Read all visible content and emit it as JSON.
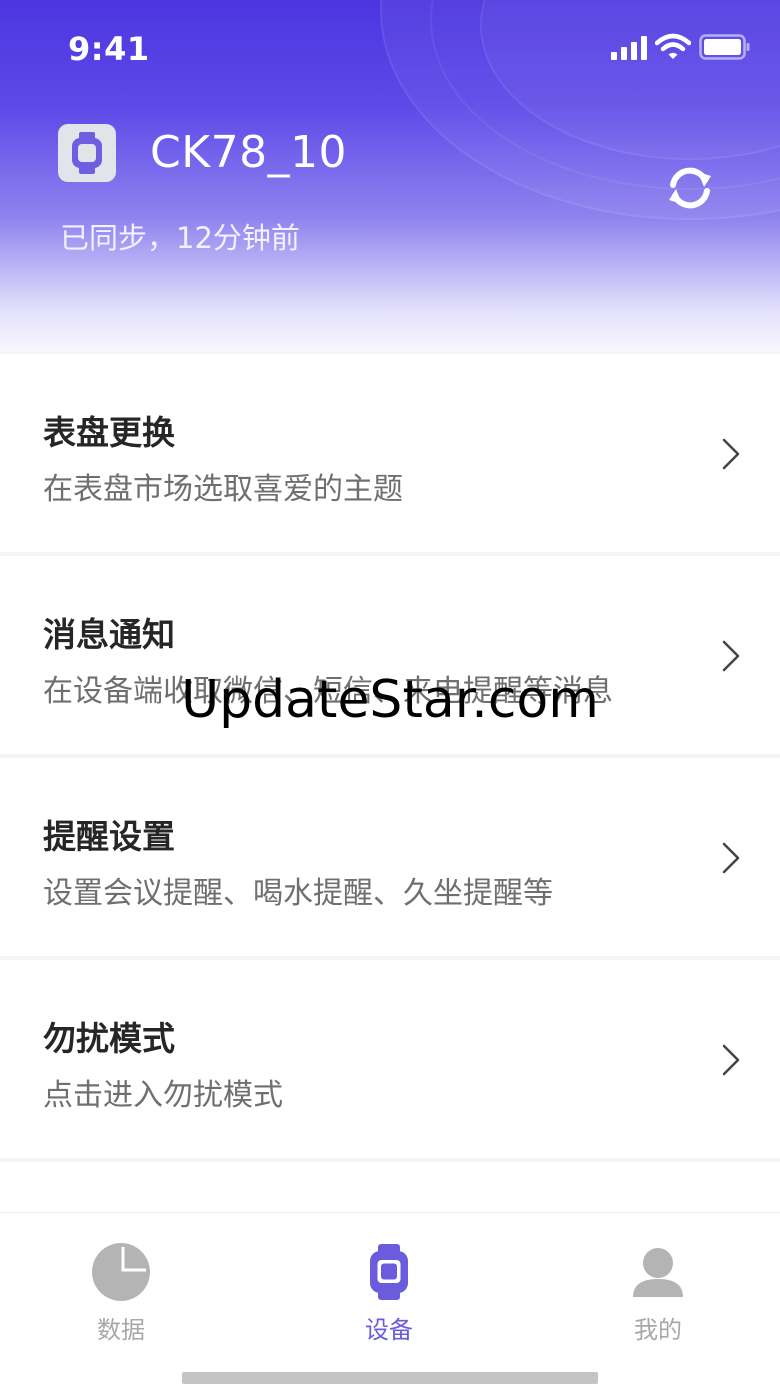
{
  "status_bar": {
    "time": "9:41"
  },
  "header": {
    "device_name": "CK78_10",
    "sync_status": "已同步，12分钟前",
    "device_icon": "watch-icon",
    "refresh_icon": "refresh-icon"
  },
  "menu": {
    "items": [
      {
        "title": "表盘更换",
        "subtitle": "在表盘市场选取喜爱的主题",
        "icon": "chevron-right-icon"
      },
      {
        "title": "消息通知",
        "subtitle": "在设备端收取微信、短信、来电提醒等消息",
        "icon": "chevron-right-icon"
      },
      {
        "title": "提醒设置",
        "subtitle": "设置会议提醒、喝水提醒、久坐提醒等",
        "icon": "chevron-right-icon"
      },
      {
        "title": "勿扰模式",
        "subtitle": "点击进入勿扰模式",
        "icon": "chevron-right-icon"
      }
    ]
  },
  "watermark": "UpdateStar.com",
  "tab_bar": {
    "tabs": [
      {
        "label": "数据",
        "icon": "pie-chart-icon",
        "active": false
      },
      {
        "label": "设备",
        "icon": "watch-icon",
        "active": true
      },
      {
        "label": "我的",
        "icon": "user-icon",
        "active": false
      }
    ]
  },
  "colors": {
    "accent": "#6a5cdc",
    "header_gradient_top": "#4c35e0",
    "header_gradient_bottom": "#f7f7fd",
    "inactive_tab": "#a8a8a8",
    "title_text": "#262626",
    "subtitle_text": "#6f6f6f"
  }
}
